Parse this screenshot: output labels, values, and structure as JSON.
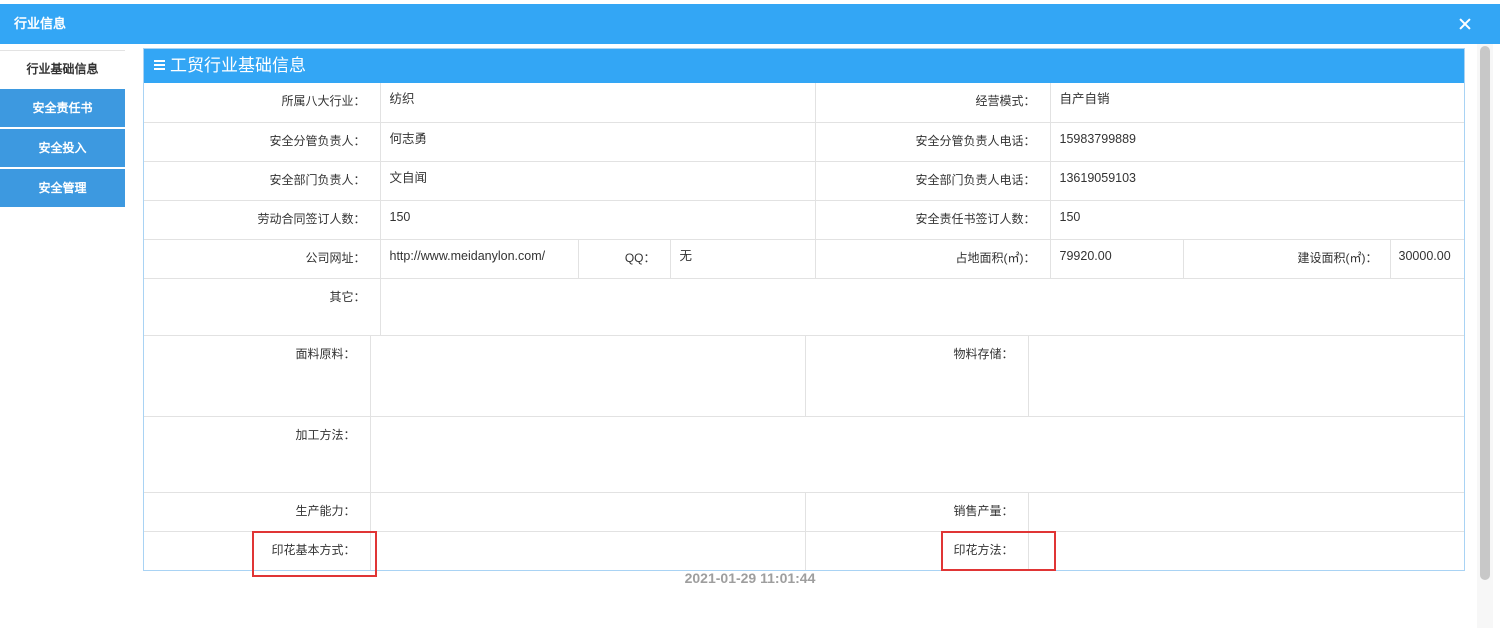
{
  "dialog": {
    "title": "行业信息"
  },
  "icons": {
    "close": "close-icon",
    "menu": "menu-icon"
  },
  "colors": {
    "title_bar": "#33a6f5",
    "panel_header": "#33a6f5",
    "sidebar_tab": "#3d99e0",
    "highlight_border": "#e03535",
    "timestamp": "#9e9e9e"
  },
  "sidebar": {
    "tabs": [
      {
        "label": "行业基础信息",
        "active": true
      },
      {
        "label": "安全责任书",
        "active": false
      },
      {
        "label": "安全投入",
        "active": false
      },
      {
        "label": "安全管理",
        "active": false
      }
    ]
  },
  "panel": {
    "title": "工贸行业基础信息"
  },
  "basic_info": {
    "industry": {
      "label": "所属八大行业：",
      "value": "纺织"
    },
    "business_mode": {
      "label": "经营模式：",
      "value": "自产自销"
    },
    "safety_leader": {
      "label": "安全分管负责人：",
      "value": "何志勇"
    },
    "safety_leader_phone": {
      "label": "安全分管负责人电话：",
      "value": "15983799889"
    },
    "safety_dept_head": {
      "label": "安全部门负责人：",
      "value": "文自闻"
    },
    "safety_dept_head_phone": {
      "label": "安全部门负责人电话：",
      "value": "13619059103"
    },
    "labor_contracts": {
      "label": "劳动合同签订人数：",
      "value": "150"
    },
    "safety_agreements": {
      "label": "安全责任书签订人数：",
      "value": "150"
    },
    "website": {
      "label": "公司网址：",
      "value": "http://www.meidanylon.com/"
    },
    "qq": {
      "label": "QQ：",
      "value": "无"
    },
    "land_area": {
      "label": "占地面积(㎡)：",
      "value": "79920.00"
    },
    "building_area": {
      "label": "建设面积(㎡)：",
      "value": "30000.00"
    },
    "other": {
      "label": "其它：",
      "value": ""
    }
  },
  "textile_info": {
    "fabric_materials": {
      "label": "面料原料：",
      "value": ""
    },
    "material_storage": {
      "label": "物料存储：",
      "value": ""
    },
    "processing_method": {
      "label": "加工方法：",
      "value": ""
    },
    "production_capacity": {
      "label": "生产能力：",
      "value": ""
    },
    "sales_volume": {
      "label": "销售产量：",
      "value": ""
    },
    "printing_basic_mode": {
      "label": "印花基本方式：",
      "value": ""
    },
    "printing_method": {
      "label": "印花方法：",
      "value": ""
    }
  },
  "timestamp": "2021-01-29 11:01:44"
}
